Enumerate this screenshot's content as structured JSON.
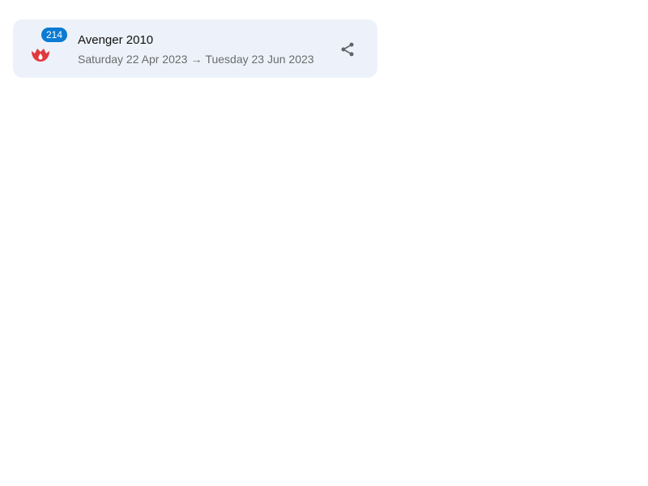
{
  "event": {
    "title": "Avenger 2010",
    "badge_count": "214",
    "start_date": "Saturday 22 Apr 2023",
    "arrow": "→",
    "end_date": "Tuesday 23 Jun 2023",
    "icon": "fire-icon",
    "share_icon": "share-icon"
  },
  "colors": {
    "card_background": "#edf2fa",
    "badge_background": "#0b7bd3",
    "icon_red": "#e03a3e"
  }
}
